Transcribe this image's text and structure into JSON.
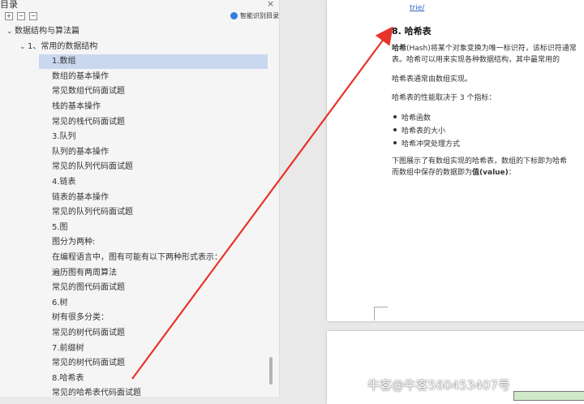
{
  "sidebar": {
    "title": "目录",
    "close": "×",
    "toolbar": {
      "expand": "+",
      "collapse": "−",
      "level": "−"
    },
    "smart_label": "智能识别目录",
    "items": [
      {
        "label": "数据结构与算法篇",
        "indent": 0,
        "chevron": "⌄"
      },
      {
        "label": "1、常用的数据结构",
        "indent": 1,
        "chevron": "⌄"
      },
      {
        "label": "1.数组",
        "indent": 2,
        "selected": true
      },
      {
        "label": "数组的基本操作",
        "indent": 2
      },
      {
        "label": "常见数组代码面试题",
        "indent": 2
      },
      {
        "label": "栈的基本操作",
        "indent": 2
      },
      {
        "label": "常见的栈代码面试题",
        "indent": 2
      },
      {
        "label": "3.队列",
        "indent": 2
      },
      {
        "label": "队列的基本操作",
        "indent": 2
      },
      {
        "label": "常见的队列代码面试题",
        "indent": 2
      },
      {
        "label": "4.链表",
        "indent": 2
      },
      {
        "label": "链表的基本操作",
        "indent": 2
      },
      {
        "label": "常见的队列代码面试题",
        "indent": 2
      },
      {
        "label": "5.图",
        "indent": 2
      },
      {
        "label": "图分为两种:",
        "indent": 2
      },
      {
        "label": "在编程语言中，图有可能有以下两种形式表示：",
        "indent": 2
      },
      {
        "label": "遍历图有两周算法",
        "indent": 2
      },
      {
        "label": "常见的图代码面试题",
        "indent": 2
      },
      {
        "label": "6.树",
        "indent": 2
      },
      {
        "label": "树有很多分类：",
        "indent": 2
      },
      {
        "label": "常见的树代码面试题",
        "indent": 2
      },
      {
        "label": "7.前缀树",
        "indent": 2
      },
      {
        "label": "常见的树代码面试题",
        "indent": 2
      },
      {
        "label": "8.哈希表",
        "indent": 2
      },
      {
        "label": "常见的哈希表代码面试题",
        "indent": 2
      }
    ]
  },
  "document": {
    "link_text": "trie/",
    "heading": "8. 哈希表",
    "para1_bold": "哈希",
    "para1_line1": "(Hash)将某个对象变换为唯一标识符，该标识符通常",
    "para1_line2": "表。哈希可以用来实现各种数据结构，其中最常用的",
    "para2": "哈希表通常由数组实现。",
    "para3": "哈希表的性能取决于 3 个指标：",
    "bullets": [
      "哈希函数",
      "哈希表的大小",
      "哈希冲突处理方式"
    ],
    "para4_line1": "下图展示了有数组实现的哈希表，数组的下标即为哈希",
    "para4_line2_pre": "而数组中保存的数据即为",
    "para4_line2_bold": "值(value)",
    "para4_line2_post": "："
  },
  "watermark": "牛客@牛客560453407号",
  "colors": {
    "selected_bg": "#c9d8ee",
    "arrow": "#e8322b",
    "link": "#2a64c5"
  }
}
